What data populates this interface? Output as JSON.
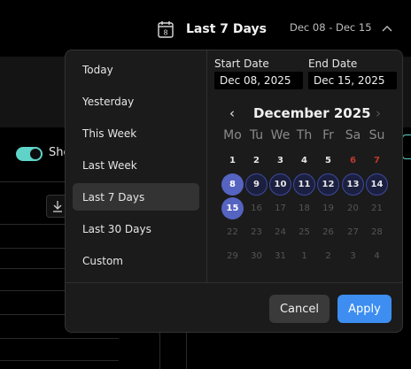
{
  "header": {
    "range_label": "Last 7 Days",
    "range_dates": "Dec 08 - Dec 15",
    "calendar_icon_day": "8"
  },
  "background": {
    "toggle_label": "Sho",
    "toggle_color": "#5fd3c8"
  },
  "picker": {
    "presets": [
      "Today",
      "Yesterday",
      "This Week",
      "Last Week",
      "Last 7 Days",
      "Last 30 Days",
      "Custom"
    ],
    "active_preset": 4,
    "start_label": "Start Date",
    "start_value": "Dec 08, 2025",
    "end_label": "End Date",
    "end_value": "Dec 15, 2025",
    "month_title": "December 2025",
    "prev_icon": "‹",
    "next_icon": "›",
    "weekdays": [
      "Mo",
      "Tu",
      "We",
      "Th",
      "Fr",
      "Sa",
      "Su"
    ],
    "weeks": [
      [
        {
          "d": "1"
        },
        {
          "d": "2"
        },
        {
          "d": "3"
        },
        {
          "d": "4"
        },
        {
          "d": "5"
        },
        {
          "d": "6",
          "s": "sunday"
        },
        {
          "d": "7",
          "s": "sunday"
        }
      ],
      [
        {
          "d": "8",
          "s": "endpoint"
        },
        {
          "d": "9",
          "s": "inrange"
        },
        {
          "d": "10",
          "s": "inrange"
        },
        {
          "d": "11",
          "s": "inrange"
        },
        {
          "d": "12",
          "s": "inrange"
        },
        {
          "d": "13",
          "s": "inrange"
        },
        {
          "d": "14",
          "s": "inrange"
        }
      ],
      [
        {
          "d": "15",
          "s": "endpoint"
        },
        {
          "d": "16",
          "s": "dim"
        },
        {
          "d": "17",
          "s": "dim"
        },
        {
          "d": "18",
          "s": "dim"
        },
        {
          "d": "19",
          "s": "dim"
        },
        {
          "d": "20",
          "s": "dim"
        },
        {
          "d": "21",
          "s": "dim"
        }
      ],
      [
        {
          "d": "22",
          "s": "dim"
        },
        {
          "d": "23",
          "s": "dim"
        },
        {
          "d": "24",
          "s": "dim"
        },
        {
          "d": "25",
          "s": "dim"
        },
        {
          "d": "26",
          "s": "dim"
        },
        {
          "d": "27",
          "s": "dim"
        },
        {
          "d": "28",
          "s": "dim"
        }
      ],
      [
        {
          "d": "29",
          "s": "dim"
        },
        {
          "d": "30",
          "s": "dim"
        },
        {
          "d": "31",
          "s": "dim"
        },
        {
          "d": "1",
          "s": "dim"
        },
        {
          "d": "2",
          "s": "dim"
        },
        {
          "d": "3",
          "s": "dim"
        },
        {
          "d": "4",
          "s": "dim"
        }
      ]
    ],
    "cancel_label": "Cancel",
    "apply_label": "Apply",
    "accent_color": "#3d8ef0",
    "range_color": "#5563c1"
  }
}
